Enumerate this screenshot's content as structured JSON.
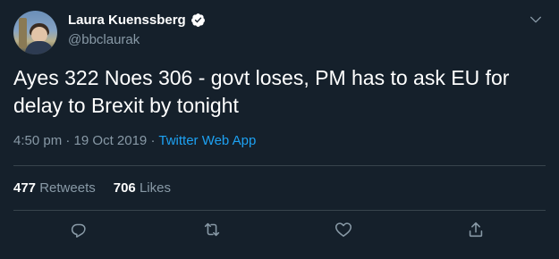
{
  "author": {
    "display_name": "Laura Kuenssberg",
    "handle": "@bbclaurak",
    "verified": true
  },
  "tweet": {
    "text": "Ayes 322 Noes 306 - govt loses, PM has to ask EU for delay to Brexit by tonight",
    "time": "4:50 pm",
    "separator": "·",
    "date": "19 Oct 2019",
    "source": "Twitter Web App"
  },
  "stats": {
    "retweets_count": "477",
    "retweets_label": "Retweets",
    "likes_count": "706",
    "likes_label": "Likes"
  },
  "icons": {
    "verified": "verified-badge-icon",
    "caret": "chevron-down-icon",
    "reply": "reply-icon",
    "retweet": "retweet-icon",
    "like": "heart-icon",
    "share": "share-icon"
  },
  "colors": {
    "background": "#15202b",
    "text": "#ffffff",
    "secondary": "#8899a6",
    "accent": "#1da1f2",
    "divider": "#38444d"
  }
}
